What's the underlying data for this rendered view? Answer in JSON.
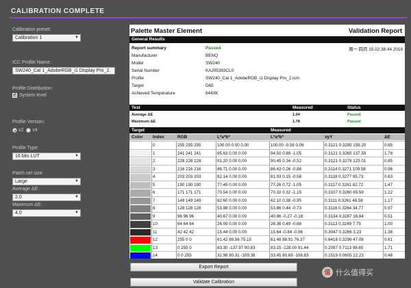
{
  "window": {
    "title": "CALIBRATION COMPLETE"
  },
  "sidebar": {
    "preset_label": "Calibration preset:",
    "preset_value": "Calibration 1",
    "icc_label": "ICC Profile Name:",
    "icc_value": "SW240_Cal 1_AdobeRGB_i1 Display Pro_2.",
    "distribution_label": "Profile Distribution:",
    "distribution_option": "System level",
    "version_label": "Profile Version:",
    "version_options": [
      "v2",
      "v4"
    ],
    "version_selected": "v2",
    "type_label": "Profile Type:",
    "type_value": "16 bits LUT",
    "patch_label": "Patch set size:",
    "patch_value": "Large",
    "avg_label": "Average ΔE:",
    "avg_value": "2.0",
    "max_label": "Maximum ΔE:",
    "max_value": "4.0"
  },
  "report": {
    "app_name": "Palette Master Element",
    "title": "Validation Report",
    "general_results": "General Results",
    "summary": {
      "report_summary_label": "Report summary",
      "report_summary_value": "Passed",
      "date": "周一 四月 15 02:38:44 2019",
      "manufacturer_label": "Manufacturer",
      "manufacturer_value": "BENQ",
      "model_label": "Model",
      "model_value": "SW240",
      "serial_label": "Serial Number",
      "serial_value": "KAJ05393CL0",
      "profile_label": "Profile",
      "profile_value": "SW240_Cal 1_AdobeRGB_i1 Display Pro_2.icm",
      "target_label": "Target",
      "target_value": "D65",
      "temp_label": "Achieved Temperature",
      "temp_value": "6443K"
    },
    "test_header": {
      "test": "Test",
      "measured": "Measured",
      "status": "Status"
    },
    "tests": [
      {
        "name": "Average ΔE",
        "measured": "1.04",
        "status": "Passed"
      },
      {
        "name": "Maximum ΔE",
        "measured": "1.78",
        "status": "Passed"
      }
    ],
    "group_header": {
      "target": "Target",
      "measured": "Measured"
    },
    "columns": {
      "color": "Color",
      "index": "Index",
      "rgb": "RGB",
      "lab_t": "L*a*b*",
      "lab_m": "L*a*b*",
      "xyy": "xyY",
      "de": "ΔE"
    },
    "rows": [
      {
        "color": "#ffffff",
        "index": "0",
        "rgb": "255  255  255",
        "lab_t": "100.00  0.00  0.00",
        "lab_m": "100.00  -0.58  0.06",
        "xyy": "0.3121  0.3295  159.20",
        "de": "0.85"
      },
      {
        "color": "#f1f1f1",
        "index": "1",
        "rgb": "241  241  241",
        "lab_t": "95.63  0.00  0.00",
        "lab_m": "94.50  0.89  -1.05",
        "xyy": "0.3121  0.3265  137.59",
        "de": "1.78"
      },
      {
        "color": "#e4e4e4",
        "index": "2",
        "rgb": "228  228  228",
        "lab_t": "91.20  0.00  0.00",
        "lab_m": "90.45  0.34  -0.52",
        "xyy": "0.3121  0.3278  123.01",
        "de": "0.85"
      },
      {
        "color": "#d8d8d8",
        "index": "3",
        "rgb": "216  216  216",
        "lab_t": "86.71  0.00  0.00",
        "lab_m": "86.43  0.26  -0.88",
        "xyy": "0.3114  0.3271  109.58",
        "de": "0.96"
      },
      {
        "color": "#cbcbcb",
        "index": "4",
        "rgb": "203  203  203",
        "lab_t": "82.14  0.00  0.00",
        "lab_m": "81.93  0.15  -0.58",
        "xyy": "0.3118  0.3277  95.73",
        "de": "0.63"
      },
      {
        "color": "#bebebe",
        "index": "5",
        "rgb": "190  190  190",
        "lab_t": "77.49  0.00  0.00",
        "lab_m": "77.26  0.72  -1.05",
        "xyy": "0.3117  0.3261  82.72",
        "de": "1.47"
      },
      {
        "color": "#ababab",
        "index": "6",
        "rgb": "171  171  171",
        "lab_t": "70.54  0.00  0.00",
        "lab_m": "70.32  0.32  -1.15",
        "xyy": "0.3107  0.3260  65.59",
        "de": "1.22"
      },
      {
        "color": "#959595",
        "index": "7",
        "rgb": "149  149  149",
        "lab_t": "62.60  0.00  0.00",
        "lab_m": "62.10  0.38  -0.95",
        "xyy": "0.3111  0.3261  48.58",
        "de": "1.17"
      },
      {
        "color": "#808080",
        "index": "8",
        "rgb": "128  128  128",
        "lab_t": "53.98  0.00  0.00",
        "lab_m": "53.86  0.44  -0.73",
        "xyy": "0.3116  0.3264  34.77",
        "de": "0.97"
      },
      {
        "color": "#606060",
        "index": "9",
        "rgb": "96  96  96",
        "lab_t": "40.67  0.00  0.00",
        "lab_m": "40.96  -0.27  -0.18",
        "xyy": "0.3134  0.3287  16.84",
        "de": "0.51"
      },
      {
        "color": "#404040",
        "index": "10",
        "rgb": "64  64  64",
        "lab_t": "26.09  0.00  0.00",
        "lab_m": "26.36  0.49  -0.68",
        "xyy": "0.3113  0.3249  7.75",
        "de": "1.00"
      },
      {
        "color": "#2a2a2a",
        "index": "11",
        "rgb": "42  42  42",
        "lab_t": "15.44  0.00  0.00",
        "lab_m": "15.64  -0.84  -0.66",
        "xyy": "0.3047  0.3266  3.23",
        "de": "1.38"
      },
      {
        "color": "#ff0000",
        "index": "12",
        "rgb": "255  0  0",
        "lab_t": "61.42  89.56  75.15",
        "lab_m": "61.48  88.91  76.37",
        "xyy": "0.6418  0.3296  47.08",
        "de": "0.61"
      },
      {
        "color": "#00ff00",
        "index": "13",
        "rgb": "0  255  0",
        "lab_t": "83.30  -137.97  90.83",
        "lab_m": "83.15  -128.00  91.44",
        "xyy": "0.2097  0.7113  98.65",
        "de": "1.71"
      },
      {
        "color": "#0000ff",
        "index": "14",
        "rgb": "0  0  255",
        "lab_t": "32.98  80.31  -109.38",
        "lab_m": "33.45  80.69  -108.83",
        "xyy": "0.1519  0.0605  12.23",
        "de": "0.48"
      }
    ]
  },
  "buttons": {
    "export": "Export Report",
    "validate": "Validate Calibration"
  },
  "watermark": {
    "text": "什么值得买"
  }
}
